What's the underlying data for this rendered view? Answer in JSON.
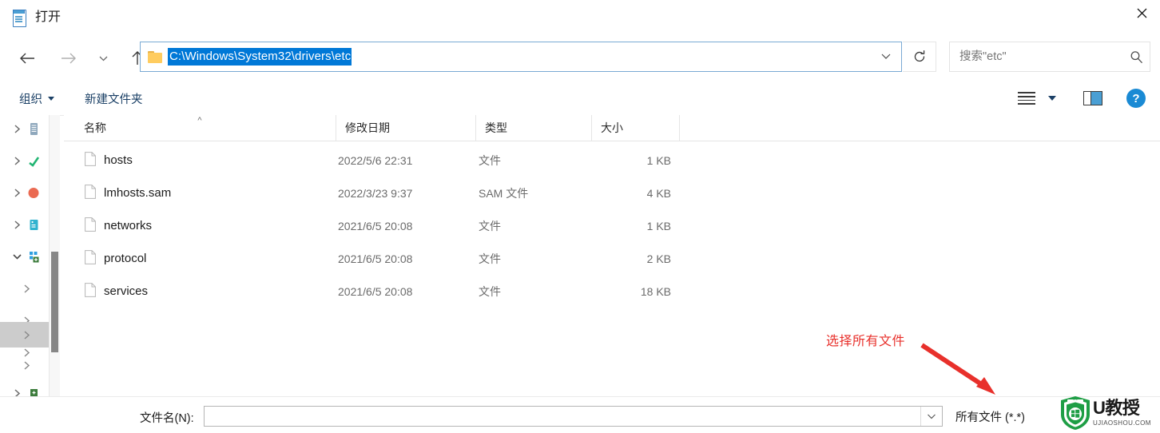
{
  "window": {
    "title": "打开",
    "title_icon": "notepad-icon",
    "close_label": "✕"
  },
  "nav": {
    "back_icon": "arrow-left-icon",
    "forward_icon": "arrow-right-icon",
    "recent_icon": "chevron-down-icon",
    "up_icon": "arrow-up-icon",
    "address_path": "C:\\Windows\\System32\\drivers\\etc",
    "address_folder_icon": "folder-icon",
    "address_caret_icon": "chevron-down-icon",
    "refresh_icon": "refresh-icon"
  },
  "search": {
    "placeholder": "搜索\"etc\"",
    "value": "",
    "icon": "search-icon"
  },
  "toolbar": {
    "organize_label": "组织",
    "new_folder_label": "新建文件夹",
    "view_icon": "list-view-icon",
    "view_caret_icon": "chevron-down-icon",
    "preview_pane_icon": "preview-pane-icon",
    "help_icon": "help-icon",
    "help_glyph": "?"
  },
  "sidebar": {
    "items": [
      {
        "name": "tree-item-1",
        "icon": "document-list-icon",
        "chevron": "chevron-right-icon",
        "expanded": false,
        "selected": false,
        "icon_color": "#7a96b0"
      },
      {
        "name": "tree-item-2",
        "icon": "green-check-icon",
        "chevron": "chevron-right-icon",
        "expanded": false,
        "selected": false,
        "icon_color": "#2eb872"
      },
      {
        "name": "tree-item-3",
        "icon": "orange-circle-icon",
        "chevron": "chevron-right-icon",
        "expanded": false,
        "selected": false,
        "icon_color": "#ea6a52"
      },
      {
        "name": "tree-item-4",
        "icon": "teal-drive-icon",
        "chevron": "chevron-right-icon",
        "expanded": false,
        "selected": false,
        "icon_color": "#2fb3cf"
      },
      {
        "name": "tree-item-5",
        "icon": "this-pc-icon",
        "chevron": "chevron-down-icon",
        "expanded": true,
        "selected": false,
        "icon_color": "#2f9fe0"
      },
      {
        "name": "tree-item-6",
        "icon": "none",
        "chevron": "chevron-right-icon",
        "expanded": false,
        "selected": false,
        "icon_color": ""
      },
      {
        "name": "tree-item-7",
        "icon": "none",
        "chevron": "chevron-right-icon",
        "expanded": false,
        "selected": false,
        "icon_color": ""
      },
      {
        "name": "tree-item-8",
        "icon": "none",
        "chevron": "chevron-right-icon",
        "expanded": false,
        "selected": false,
        "icon_color": ""
      },
      {
        "name": "tree-item-9",
        "icon": "none",
        "chevron": "chevron-right-icon",
        "expanded": false,
        "selected": true,
        "icon_color": ""
      },
      {
        "name": "tree-item-10",
        "icon": "none",
        "chevron": "chevron-right-icon",
        "expanded": false,
        "selected": false,
        "icon_color": ""
      },
      {
        "name": "tree-item-11",
        "icon": "green-drive-icon",
        "chevron": "chevron-right-icon",
        "expanded": false,
        "selected": false,
        "icon_color": "#3c7c3c"
      }
    ],
    "scrollbar": "vertical-scrollbar"
  },
  "filelist": {
    "columns": [
      {
        "key": "name",
        "label": "名称",
        "sorted": true,
        "sort_mark": "^"
      },
      {
        "key": "date",
        "label": "修改日期",
        "sorted": false,
        "sort_mark": ""
      },
      {
        "key": "type",
        "label": "类型",
        "sorted": false,
        "sort_mark": ""
      },
      {
        "key": "size",
        "label": "大小",
        "sorted": false,
        "sort_mark": ""
      }
    ],
    "rows": [
      {
        "name": "hosts",
        "date": "2022/5/6 22:31",
        "type": "文件",
        "size": "1 KB",
        "icon": "file-icon"
      },
      {
        "name": "lmhosts.sam",
        "date": "2022/3/23 9:37",
        "type": "SAM 文件",
        "size": "4 KB",
        "icon": "file-icon"
      },
      {
        "name": "networks",
        "date": "2021/6/5 20:08",
        "type": "文件",
        "size": "1 KB",
        "icon": "file-icon"
      },
      {
        "name": "protocol",
        "date": "2021/6/5 20:08",
        "type": "文件",
        "size": "2 KB",
        "icon": "file-icon"
      },
      {
        "name": "services",
        "date": "2021/6/5 20:08",
        "type": "文件",
        "size": "18 KB",
        "icon": "file-icon"
      }
    ]
  },
  "bottom": {
    "filename_label": "文件名(N):",
    "filename_value": "",
    "filename_caret_icon": "chevron-down-icon",
    "filter_value": "所有文件 (*.*)",
    "filter_caret_icon": "chevron-down-icon"
  },
  "annotation": {
    "text": "选择所有文件",
    "color": "#e8302b",
    "arrow": "arrow-down-right-icon"
  },
  "watermark": {
    "brand": "U教授",
    "domain": "UJIAOSHOU.COM",
    "shield_color": "#1e9e45"
  }
}
